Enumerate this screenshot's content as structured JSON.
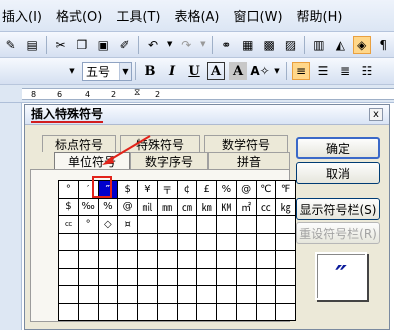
{
  "menubar": {
    "items": [
      "插入(I)",
      "格式(O)",
      "工具(T)",
      "表格(A)",
      "窗口(W)",
      "帮助(H)"
    ]
  },
  "toolbar": {
    "font_size": "五号",
    "bold_label": "B",
    "italic_label": "I",
    "underline_label": "U",
    "font_a_label": "A",
    "char_a_label": "A"
  },
  "ruler": {
    "numbers": [
      "8",
      "6",
      "4",
      "2",
      "2"
    ]
  },
  "dialog": {
    "title": "插入特殊符号",
    "close_label": "x",
    "tabs": [
      {
        "label": "标点符号"
      },
      {
        "label": "特殊符号"
      },
      {
        "label": "数学符号"
      },
      {
        "label": "单位符号"
      },
      {
        "label": "数字序号"
      },
      {
        "label": "拼音"
      }
    ],
    "selected_tab": "单位符号",
    "buttons": {
      "ok": "确定",
      "cancel": "取消",
      "show_bar": "显示符号栏(S)",
      "reset_bar": "重设符号栏(R)"
    },
    "grid": [
      [
        "°",
        "′",
        "″",
        "$",
        "¥",
        "〒",
        "¢",
        "£",
        "%",
        "@",
        "℃",
        "℉"
      ],
      [
        "$",
        "‰",
        "%",
        "@",
        "㏕",
        "㎜",
        "㎝",
        "㎞",
        "㏎",
        "㎡",
        "㏄",
        "㎏"
      ],
      [
        "cc",
        "°",
        "◇",
        "¤",
        "",
        "",
        "",
        "",
        "",
        "",
        "",
        ""
      ],
      [
        "",
        "",
        "",
        "",
        "",
        "",
        "",
        "",
        "",
        "",
        "",
        ""
      ],
      [
        "",
        "",
        "",
        "",
        "",
        "",
        "",
        "",
        "",
        "",
        "",
        ""
      ],
      [
        "",
        "",
        "",
        "",
        "",
        "",
        "",
        "",
        "",
        "",
        "",
        ""
      ],
      [
        "",
        "",
        "",
        "",
        "",
        "",
        "",
        "",
        "",
        "",
        "",
        ""
      ],
      [
        "",
        "",
        "",
        "",
        "",
        "",
        "",
        "",
        "",
        "",
        "",
        ""
      ]
    ],
    "selected_symbol": "″",
    "preview_symbol": "″"
  },
  "colors": {
    "highlight": "#e2231a",
    "selection": "#0000cc"
  }
}
